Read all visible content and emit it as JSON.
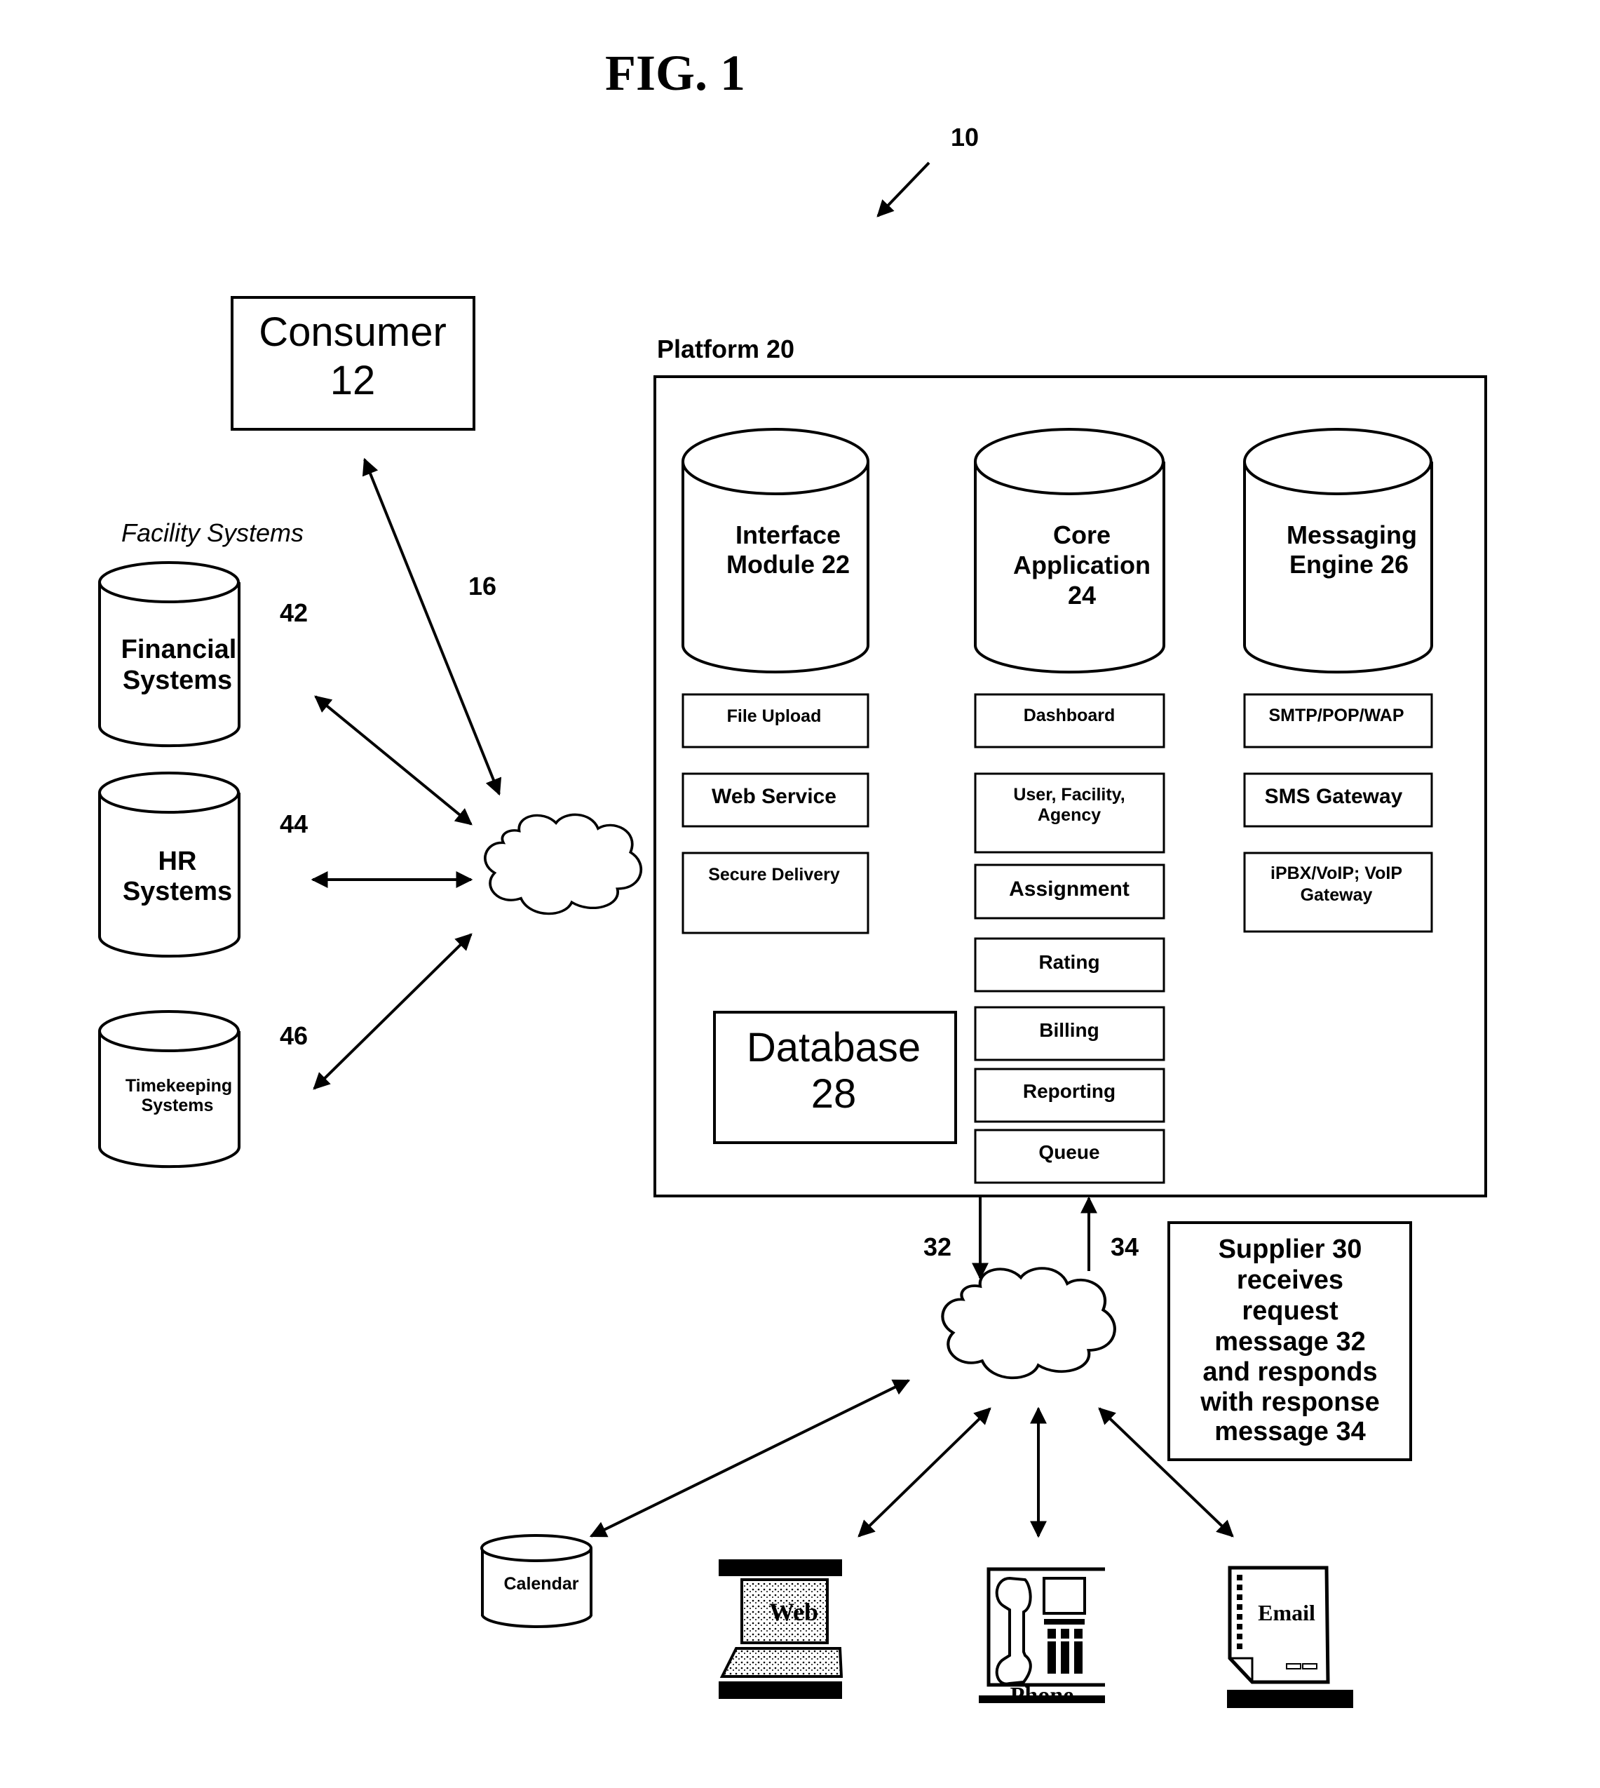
{
  "figure": {
    "title": "FIG. 1",
    "system_ref": "10"
  },
  "consumer": {
    "line1": "Consumer",
    "line2": "12"
  },
  "link_ref_16": "16",
  "facility": {
    "heading": "Facility Systems",
    "systems": [
      {
        "line1": "Financial",
        "line2": "Systems",
        "ref": "42"
      },
      {
        "line1": "HR",
        "line2": "Systems",
        "ref": "44"
      },
      {
        "line1": "Timekeeping",
        "line2": "Systems",
        "ref": "46"
      }
    ]
  },
  "platform": {
    "label": "Platform 20",
    "modules": [
      {
        "lines": [
          "Interface",
          "Module 22"
        ]
      },
      {
        "lines": [
          "Core",
          "Application",
          "24"
        ]
      },
      {
        "lines": [
          "Messaging",
          "Engine 26"
        ]
      }
    ],
    "interface_items": [
      "File Upload",
      "Web Service",
      "Secure Delivery"
    ],
    "core_items": [
      [
        "Dashboard"
      ],
      [
        "User, Facility,",
        "Agency"
      ],
      [
        "Assignment"
      ],
      [
        "Rating"
      ],
      [
        "Billing"
      ],
      [
        "Reporting"
      ],
      [
        "Queue"
      ]
    ],
    "messaging_items": [
      [
        "SMTP/POP/WAP"
      ],
      [
        "SMS Gateway"
      ],
      [
        "iPBX/VoIP; VoIP",
        "Gateway"
      ]
    ],
    "database": {
      "line1": "Database",
      "line2": "28"
    }
  },
  "messages": {
    "request_ref": "32",
    "response_ref": "34"
  },
  "supplier_note": {
    "lines": [
      "Supplier  30",
      "receives",
      "request",
      "message 32",
      "and responds",
      "with response",
      "message 34"
    ]
  },
  "channels": {
    "calendar": "Calendar",
    "web": "Web",
    "phone": "Phone",
    "email": "Email"
  }
}
